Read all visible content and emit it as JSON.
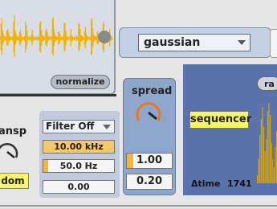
{
  "waveform": {
    "normalize_label": "normalize"
  },
  "distribution": {
    "selected": "gaussian"
  },
  "filter": {
    "type": "Filter Off",
    "frequency": "10.00 kHz",
    "q": "50.0 Hz",
    "gain": "0.00"
  },
  "transp": {
    "label": "ansp",
    "mode_label": "dom"
  },
  "spread": {
    "label": "spread",
    "value1": "1.00",
    "value2": "0.20"
  },
  "sequencer": {
    "label": "sequencer",
    "time_label": "Δtime",
    "time_value": "1741",
    "ra_label": "ra"
  },
  "colors": {
    "accent_yellow": "#f7f56a",
    "waveform": "#f2b200",
    "panel_blue": "#5a73aa"
  },
  "icons": [
    "dropdown-arrow-icon",
    "knob-icon"
  ]
}
